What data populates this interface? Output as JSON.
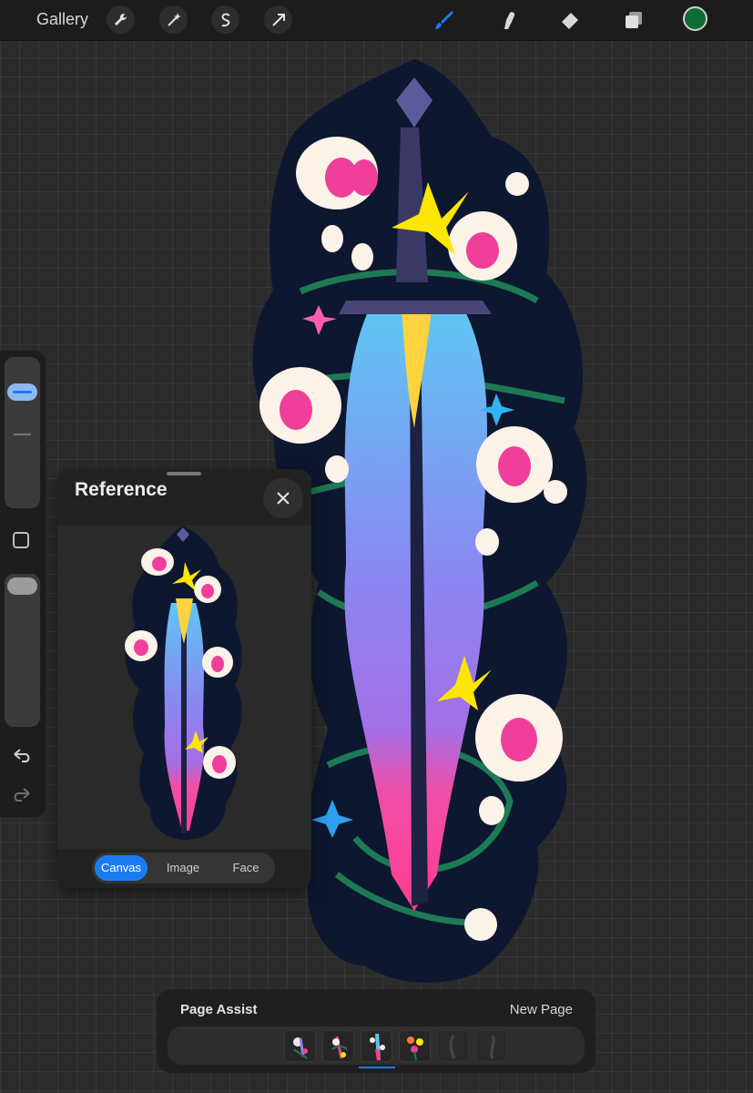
{
  "topbar": {
    "gallery_label": "Gallery",
    "tools": [
      "wrench-icon",
      "magic-wand-icon",
      "selection-icon",
      "transform-arrow-icon"
    ],
    "right_tools": [
      "brush-icon",
      "smudge-icon",
      "eraser-icon",
      "layers-icon"
    ],
    "current_color": "#0d6b35",
    "accent": "#1b7cf0"
  },
  "reference": {
    "title": "Reference",
    "tabs": [
      {
        "label": "Canvas",
        "active": true
      },
      {
        "label": "Image",
        "active": false
      },
      {
        "label": "Face",
        "active": false
      }
    ]
  },
  "page_assist": {
    "title": "Page Assist",
    "new_page_label": "New Page",
    "page_count": 6,
    "selected_page": 3
  }
}
